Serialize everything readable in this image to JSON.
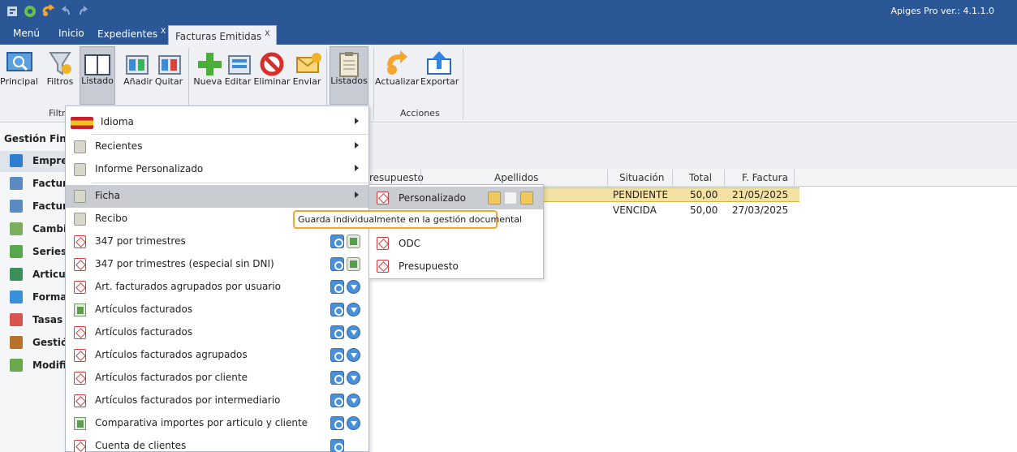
{
  "app": {
    "version_label": "Apiges Pro ver.: 4.1.1.0",
    "quick_access": [
      "app-logo-icon",
      "refresh-icon",
      "undo-icon",
      "back-icon",
      "forward-icon"
    ]
  },
  "menubar": {
    "menu": "Menú",
    "inicio": "Inicio",
    "tabs": [
      {
        "label": "Expedientes",
        "close": "X"
      },
      {
        "label": "Facturas Emitidas",
        "close": "X"
      }
    ]
  },
  "ribbon": {
    "buttons": {
      "principal": "Principal",
      "filtros": "Filtros",
      "listado": "Listado",
      "anadir": "Añadir",
      "quitar": "Quitar",
      "nueva": "Nueva",
      "editar": "Editar",
      "eliminar": "Eliminar",
      "enviar": "Enviar",
      "listados": "Listados",
      "actualizar": "Actualizar",
      "exportar": "Exportar"
    },
    "groups": {
      "filtros": "Filtro",
      "acciones": "Acciones"
    }
  },
  "sidebar": {
    "title": "Gestión Fina",
    "items": [
      {
        "label": "Empres",
        "icon": "chart-icon",
        "color": "#2f7fd0"
      },
      {
        "label": "Factura",
        "icon": "invoice-icon",
        "color": "#5b8ac2"
      },
      {
        "label": "Factura",
        "icon": "invoice-icon",
        "color": "#5b8ac2"
      },
      {
        "label": "Cambio",
        "icon": "calculator-icon",
        "color": "#7cae5f"
      },
      {
        "label": "Series",
        "icon": "series-icon",
        "color": "#57a84a"
      },
      {
        "label": "Articul",
        "icon": "articles-icon",
        "color": "#3c8f56"
      },
      {
        "label": "Formas",
        "icon": "payment-icon",
        "color": "#3a8fd8"
      },
      {
        "label": "Tasas",
        "icon": "tag-icon",
        "color": "#d9534f"
      },
      {
        "label": "Gestión",
        "icon": "briefcase-icon",
        "color": "#b8722c"
      },
      {
        "label": "Modific",
        "icon": "modify-icon",
        "color": "#6aa84f"
      }
    ]
  },
  "grid": {
    "headers": {
      "presupuesto": "resupuesto",
      "apellidos": "Apellidos",
      "situacion": "Situación",
      "total": "Total",
      "fecha": "F. Factura"
    },
    "rows": [
      {
        "situacion": "PENDIENTE",
        "total": "50,00",
        "fecha": "21/05/2025"
      },
      {
        "situacion": "VENCIDA",
        "total": "50,00",
        "fecha": "27/03/2025"
      }
    ]
  },
  "dropdown": {
    "items": [
      {
        "label": "Idioma"
      },
      {
        "label": "Recientes"
      },
      {
        "label": "Informe Personalizado"
      },
      {
        "label": "Ficha"
      },
      {
        "label": "Recibo"
      },
      {
        "label": "347 por trimestres"
      },
      {
        "label": "347 por trimestres (especial sin DNI)"
      },
      {
        "label": "Art. facturados agrupados por usuario"
      },
      {
        "label": "Artículos facturados"
      },
      {
        "label": "Artículos facturados"
      },
      {
        "label": "Artículos facturados agrupados"
      },
      {
        "label": "Artículos facturados por cliente"
      },
      {
        "label": "Artículos facturados por intermediario"
      },
      {
        "label": "Comparativa importes por articulo y cliente"
      },
      {
        "label": "Cuenta de clientes"
      }
    ]
  },
  "submenu": {
    "items": [
      {
        "label": "Personalizado"
      },
      {
        "label": "ODC"
      },
      {
        "label": "Presupuesto"
      }
    ]
  },
  "tooltip": {
    "text": "Guarda individualmente en la gestión documental"
  }
}
